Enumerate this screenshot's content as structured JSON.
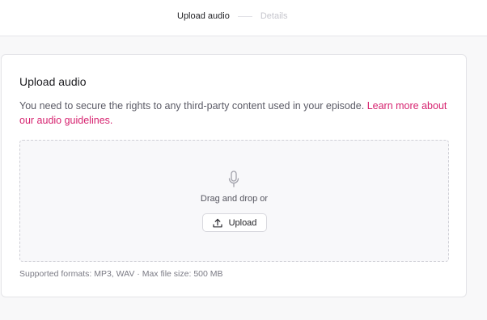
{
  "stepper": {
    "step1": "Upload audio",
    "step2": "Details"
  },
  "card": {
    "title": "Upload audio",
    "description": "You need to secure the rights to any third-party content used in your episode.",
    "link": "Learn more about our audio guidelines.",
    "dropzone": {
      "icon": "microphone-icon",
      "text": "Drag and drop or",
      "button_label": "Upload",
      "button_icon": "upload-icon"
    },
    "formats": "Supported formats: MP3, WAV · Max file size: 500 MB"
  },
  "colors": {
    "accent_link": "#d6226f",
    "background": "#f8f8f9"
  }
}
